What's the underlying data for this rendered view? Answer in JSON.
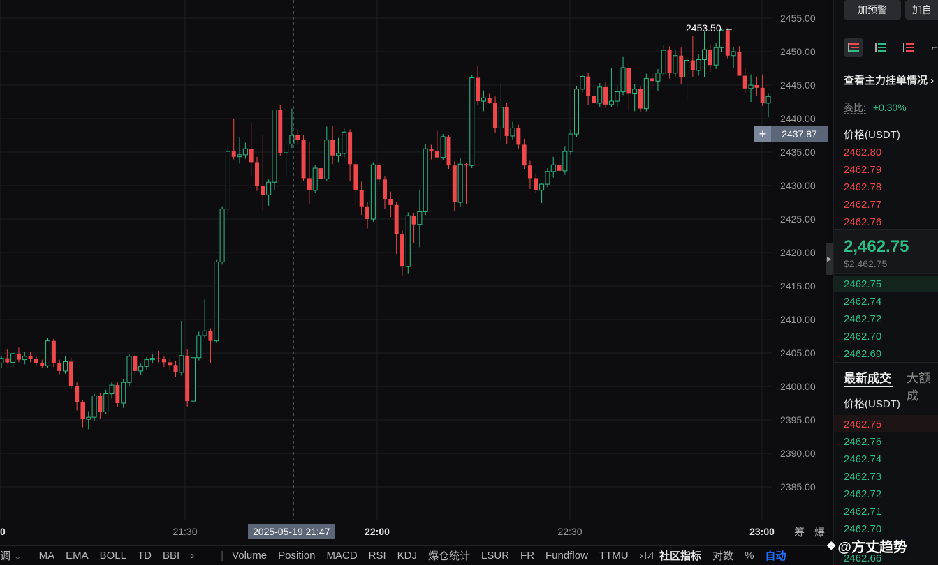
{
  "chart_data": {
    "type": "candlestick",
    "y_ticks": [
      "2455.00",
      "2450.00",
      "2445.00",
      "2440.00",
      "2435.00",
      "2430.00",
      "2425.00",
      "2420.00",
      "2415.00",
      "2410.00",
      "2405.00",
      "2400.00",
      "2395.00",
      "2390.00",
      "2385.00"
    ],
    "ylim": [
      2381,
      2458
    ],
    "x_ticks": [
      {
        "label": "0",
        "bold": true
      },
      {
        "label": "21:30",
        "bold": false
      },
      {
        "label": "22:00",
        "bold": true
      },
      {
        "label": "22:30",
        "bold": false
      },
      {
        "label": "23:00",
        "bold": true
      }
    ],
    "candles": [
      [
        2403.5,
        2404.6,
        2402.8,
        2404.2
      ],
      [
        2404.2,
        2405.5,
        2403.4,
        2403.6
      ],
      [
        2403.6,
        2405.1,
        2402.7,
        2404.9
      ],
      [
        2404.9,
        2405.8,
        2403.6,
        2404.0
      ],
      [
        2404.0,
        2405.2,
        2403.3,
        2404.5
      ],
      [
        2404.5,
        2405.2,
        2403.6,
        2404.1
      ],
      [
        2404.1,
        2404.6,
        2403.2,
        2403.5
      ],
      [
        2403.5,
        2404.0,
        2402.7,
        2403.1
      ],
      [
        2403.1,
        2407.3,
        2402.8,
        2406.8
      ],
      [
        2406.8,
        2407.1,
        2402.9,
        2403.5
      ],
      [
        2403.5,
        2404.0,
        2401.8,
        2402.3
      ],
      [
        2402.3,
        2404.5,
        2401.9,
        2403.7
      ],
      [
        2403.7,
        2404.3,
        2399.6,
        2400.1
      ],
      [
        2400.1,
        2400.6,
        2396.4,
        2397.6
      ],
      [
        2397.6,
        2397.9,
        2393.9,
        2395.1
      ],
      [
        2395.1,
        2396.3,
        2393.6,
        2395.4
      ],
      [
        2395.4,
        2398.9,
        2394.9,
        2398.6
      ],
      [
        2398.6,
        2399.0,
        2395.2,
        2396.2
      ],
      [
        2396.2,
        2399.5,
        2395.9,
        2398.9
      ],
      [
        2398.9,
        2400.7,
        2398.2,
        2400.2
      ],
      [
        2400.2,
        2400.6,
        2396.9,
        2397.5
      ],
      [
        2397.5,
        2401.1,
        2396.8,
        2400.6
      ],
      [
        2400.6,
        2404.9,
        2400.1,
        2404.5
      ],
      [
        2404.5,
        2404.7,
        2401.8,
        2402.3
      ],
      [
        2402.3,
        2403.4,
        2401.7,
        2403.0
      ],
      [
        2403.0,
        2404.4,
        2402.5,
        2404.0
      ],
      [
        2404.0,
        2404.8,
        2403.5,
        2404.2
      ],
      [
        2404.2,
        2405.3,
        2403.6,
        2404.1
      ],
      [
        2404.1,
        2404.5,
        2402.9,
        2403.6
      ],
      [
        2403.6,
        2404.2,
        2402.5,
        2403.2
      ],
      [
        2403.2,
        2403.8,
        2401.4,
        2402.1
      ],
      [
        2402.1,
        2409.8,
        2401.6,
        2404.6
      ],
      [
        2404.6,
        2405.5,
        2397.0,
        2397.8
      ],
      [
        2397.8,
        2404.7,
        2395.2,
        2404.3
      ],
      [
        2404.3,
        2408.2,
        2403.9,
        2407.6
      ],
      [
        2407.6,
        2413.0,
        2407.2,
        2408.3
      ],
      [
        2408.3,
        2408.7,
        2403.5,
        2406.8
      ],
      [
        2406.8,
        2418.9,
        2406.5,
        2418.6
      ],
      [
        2418.6,
        2426.8,
        2418.2,
        2426.5
      ],
      [
        2426.5,
        2436.0,
        2425.7,
        2435.1
      ],
      [
        2435.1,
        2439.9,
        2433.9,
        2434.3
      ],
      [
        2434.3,
        2437.2,
        2433.3,
        2434.6
      ],
      [
        2434.6,
        2436.4,
        2434.0,
        2435.5
      ],
      [
        2435.5,
        2439.3,
        2431.5,
        2433.5
      ],
      [
        2433.5,
        2434.3,
        2429.2,
        2429.9
      ],
      [
        2429.9,
        2437.6,
        2426.3,
        2428.6
      ],
      [
        2428.6,
        2430.9,
        2427.0,
        2430.5
      ],
      [
        2430.5,
        2436.7,
        2429.4,
        2441.3
      ],
      [
        2441.3,
        2442.0,
        2434.4,
        2434.9
      ],
      [
        2434.9,
        2436.8,
        2431.5,
        2436.2
      ],
      [
        2436.2,
        2441.5,
        2435.6,
        2437.5
      ],
      [
        2437.5,
        2438.4,
        2436.1,
        2436.8
      ],
      [
        2436.8,
        2437.6,
        2430.7,
        2431.1
      ],
      [
        2431.1,
        2436.5,
        2427.3,
        2429.3
      ],
      [
        2429.3,
        2433.1,
        2428.9,
        2432.6
      ],
      [
        2432.6,
        2437.2,
        2431.5,
        2431.0
      ],
      [
        2431.0,
        2438.8,
        2430.7,
        2436.8
      ],
      [
        2436.8,
        2438.9,
        2433.2,
        2434.5
      ],
      [
        2434.5,
        2437.1,
        2433.5,
        2434.8
      ],
      [
        2434.8,
        2438.5,
        2434.2,
        2438.0
      ],
      [
        2438.0,
        2438.4,
        2430.7,
        2433.2
      ],
      [
        2433.2,
        2433.7,
        2427.1,
        2429.3
      ],
      [
        2429.3,
        2430.6,
        2425.6,
        2426.8
      ],
      [
        2426.8,
        2427.6,
        2423.6,
        2425.0
      ],
      [
        2425.0,
        2433.5,
        2424.6,
        2433.1
      ],
      [
        2433.1,
        2433.5,
        2430.2,
        2430.9
      ],
      [
        2430.9,
        2431.4,
        2426.5,
        2428.0
      ],
      [
        2428.0,
        2429.1,
        2425.3,
        2427.1
      ],
      [
        2427.1,
        2427.6,
        2419.8,
        2422.7
      ],
      [
        2422.7,
        2423.3,
        2416.6,
        2417.9
      ],
      [
        2417.9,
        2426.0,
        2416.8,
        2425.5
      ],
      [
        2425.5,
        2425.9,
        2421.4,
        2424.2
      ],
      [
        2424.2,
        2429.4,
        2420.8,
        2426.1
      ],
      [
        2426.1,
        2436.2,
        2425.6,
        2435.5
      ],
      [
        2435.5,
        2436.1,
        2433.9,
        2435.1
      ],
      [
        2435.1,
        2438.2,
        2434.4,
        2434.2
      ],
      [
        2434.2,
        2437.7,
        2433.8,
        2437.3
      ],
      [
        2437.3,
        2437.6,
        2432.4,
        2433.0
      ],
      [
        2433.0,
        2433.6,
        2426.2,
        2427.5
      ],
      [
        2427.5,
        2434.1,
        2426.8,
        2433.2
      ],
      [
        2433.2,
        2433.4,
        2427.3,
        2433.0
      ],
      [
        2433.0,
        2446.5,
        2432.6,
        2446.1
      ],
      [
        2446.1,
        2447.9,
        2442.0,
        2442.6
      ],
      [
        2442.6,
        2444.2,
        2441.1,
        2443.1
      ],
      [
        2443.1,
        2443.7,
        2442.2,
        2442.3
      ],
      [
        2442.3,
        2443.3,
        2437.9,
        2438.6
      ],
      [
        2438.6,
        2445.1,
        2436.7,
        2441.7
      ],
      [
        2441.7,
        2442.3,
        2436.2,
        2437.4
      ],
      [
        2437.4,
        2439.5,
        2436.8,
        2438.6
      ],
      [
        2438.6,
        2439.1,
        2435.4,
        2436.1
      ],
      [
        2436.1,
        2437.0,
        2432.4,
        2433.0
      ],
      [
        2433.0,
        2433.7,
        2429.5,
        2431.1
      ],
      [
        2431.1,
        2431.8,
        2428.9,
        2429.3
      ],
      [
        2429.3,
        2430.3,
        2427.4,
        2430.2
      ],
      [
        2430.2,
        2432.6,
        2429.8,
        2432.1
      ],
      [
        2432.1,
        2434.3,
        2431.2,
        2433.1
      ],
      [
        2433.1,
        2434.5,
        2432.7,
        2432.2
      ],
      [
        2432.2,
        2435.8,
        2431.6,
        2435.1
      ],
      [
        2435.1,
        2438.3,
        2434.6,
        2437.7
      ],
      [
        2437.7,
        2444.8,
        2437.2,
        2444.4
      ],
      [
        2444.4,
        2446.6,
        2443.9,
        2446.3
      ],
      [
        2446.3,
        2446.8,
        2442.0,
        2443.4
      ],
      [
        2443.4,
        2444.7,
        2442.1,
        2442.3
      ],
      [
        2442.3,
        2445.3,
        2441.7,
        2444.7
      ],
      [
        2444.7,
        2445.5,
        2441.6,
        2442.1
      ],
      [
        2442.1,
        2447.6,
        2441.7,
        2442.6
      ],
      [
        2442.6,
        2444.8,
        2441.8,
        2444.0
      ],
      [
        2444.0,
        2449.3,
        2443.5,
        2447.6
      ],
      [
        2447.6,
        2448.2,
        2441.2,
        2443.7
      ],
      [
        2443.7,
        2445.2,
        2441.1,
        2444.4
      ],
      [
        2444.4,
        2444.9,
        2441.0,
        2441.5
      ],
      [
        2441.5,
        2446.7,
        2441.1,
        2446.0
      ],
      [
        2446.0,
        2446.7,
        2444.4,
        2445.6
      ],
      [
        2445.6,
        2447.4,
        2444.1,
        2446.8
      ],
      [
        2446.8,
        2451.0,
        2446.4,
        2450.2
      ],
      [
        2450.2,
        2450.8,
        2446.0,
        2446.8
      ],
      [
        2446.8,
        2450.2,
        2446.3,
        2449.4
      ],
      [
        2449.4,
        2450.6,
        2445.2,
        2446.2
      ],
      [
        2446.2,
        2449.2,
        2442.7,
        2448.7
      ],
      [
        2448.7,
        2452.3,
        2446.2,
        2447.2
      ],
      [
        2447.2,
        2449.6,
        2446.4,
        2448.8
      ],
      [
        2448.8,
        2453.0,
        2446.2,
        2450.3
      ],
      [
        2450.3,
        2451.1,
        2447.0,
        2448.0
      ],
      [
        2448.0,
        2451.3,
        2447.4,
        2450.6
      ],
      [
        2450.6,
        2453.5,
        2450.0,
        2453.2
      ],
      [
        2453.2,
        2453.5,
        2449.0,
        2449.4
      ],
      [
        2449.4,
        2450.7,
        2447.6,
        2450.0
      ],
      [
        2450.0,
        2450.8,
        2446.5,
        2446.4
      ],
      [
        2446.4,
        2447.5,
        2443.7,
        2444.5
      ],
      [
        2444.5,
        2446.6,
        2442.5,
        2445.0
      ],
      [
        2445.0,
        2446.3,
        2443.4,
        2444.6
      ],
      [
        2444.6,
        2446.6,
        2441.9,
        2442.3
      ],
      [
        2442.3,
        2443.7,
        2440.2,
        2443.3
      ]
    ],
    "max_marker": {
      "label": "2453.50",
      "value": 2453.5
    },
    "crosshair": {
      "price": 2437.87,
      "price_label": "2437.87",
      "time_label": "2025-05-19 21:47"
    },
    "colors": {
      "up": "#2ebd85",
      "down": "#f0474b",
      "grid": "#1d1e22"
    }
  },
  "header": {
    "alert_button": "加预警",
    "custom_button": "加自"
  },
  "indicator_bar": {
    "left_fragment": "调",
    "items": [
      "MA",
      "EMA",
      "BOLL",
      "TD",
      "BBI"
    ],
    "sub_items": [
      "Volume",
      "Position",
      "MACD",
      "RSI",
      "KDJ",
      "爆仓统计",
      "LSUR",
      "FR",
      "Fundflow",
      "TTMU"
    ],
    "community": "社区指标",
    "log_scale": "对数",
    "percent": "%",
    "auto": "自动",
    "corner_labels": [
      "筹",
      "爆"
    ]
  },
  "order_book": {
    "view_orders_link": "查看主力挂单情况",
    "ratio_label": "委比:",
    "ratio_value": "+0.30%",
    "price_header": "价格(USDT)",
    "asks": [
      "2462.80",
      "2462.79",
      "2462.78",
      "2462.77",
      "2462.76"
    ],
    "last_price": "2,462.75",
    "last_price_usd": "$2,462.75",
    "bids": [
      "2462.75",
      "2462.74",
      "2462.72",
      "2462.70",
      "2462.69"
    ]
  },
  "trades": {
    "tab_latest": "最新成交",
    "tab_large": "大额成",
    "price_header": "价格(USDT)",
    "rows": [
      {
        "price": "2462.75",
        "side": "down"
      },
      {
        "price": "2462.76",
        "side": "up"
      },
      {
        "price": "2462.74",
        "side": "up"
      },
      {
        "price": "2462.73",
        "side": "up"
      },
      {
        "price": "2462.72",
        "side": "up"
      },
      {
        "price": "2462.71",
        "side": "up"
      },
      {
        "price": "2462.70",
        "side": "up"
      },
      {
        "price": "2462.66",
        "side": "up"
      }
    ]
  },
  "watermark": "@方丈趋势"
}
